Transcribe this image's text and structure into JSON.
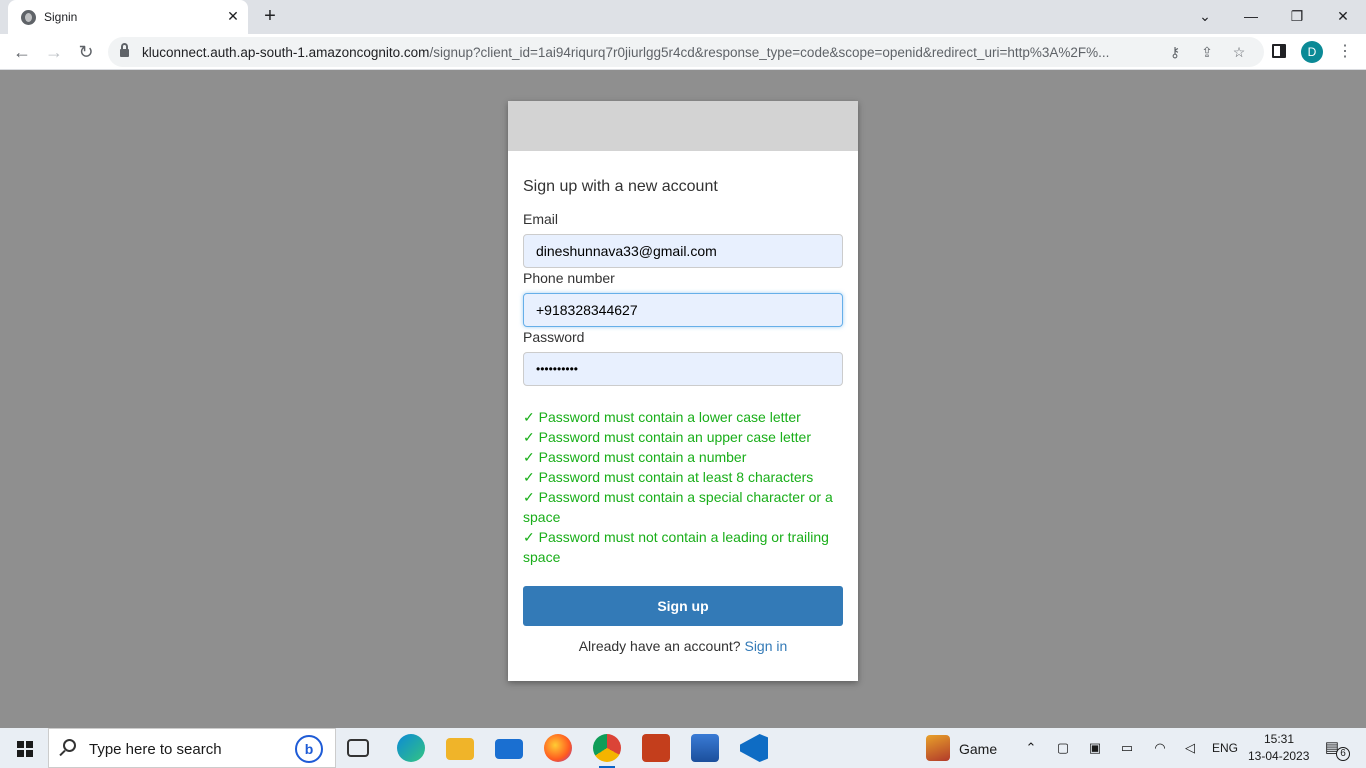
{
  "browser": {
    "tab": {
      "title": "Signin",
      "close": "✕"
    },
    "new_tab": "+",
    "window_controls": {
      "dropdown": "⌄",
      "minimize": "—",
      "restore": "❐",
      "close": "✕"
    },
    "nav": {
      "back": "←",
      "forward": "→",
      "reload": "↻"
    },
    "url_host": "kluconnect.auth.ap-south-1.amazoncognito.com",
    "url_rest": "/signup?client_id=1ai94riqurq7r0jiurlgg5r4cd&response_type=code&scope=openid&redirect_uri=http%3A%2F%...",
    "omnibox_icons": {
      "key": "⚷",
      "share": "⇪",
      "bookmark": "☆"
    },
    "profile_initial": "D",
    "menu": "⋮"
  },
  "form": {
    "heading": "Sign up with a new account",
    "email_label": "Email",
    "email_value": "dineshunnava33@gmail.com",
    "phone_label": "Phone number",
    "phone_value": "+918328344627",
    "password_label": "Password",
    "password_value": "••••••••••",
    "rules": [
      "✓ Password must contain a lower case letter",
      "✓ Password must contain an upper case letter",
      "✓ Password must contain a number",
      "✓ Password must contain at least 8 characters",
      "✓ Password must contain a special character or a space",
      "✓ Password must not contain a leading or trailing space"
    ],
    "signup_button": "Sign up",
    "already_text": "Already have an account?",
    "signin_link": "Sign in"
  },
  "taskbar": {
    "search_placeholder": "Type here to search",
    "bing": "b",
    "widget_label": "Game",
    "lang": "ENG",
    "time": "15:31",
    "date": "13-04-2023",
    "notification_count": "6"
  },
  "colors": {
    "backdrop": "#8f8f8f",
    "primary_button": "#337ab7",
    "rule_ok": "#19ae19",
    "input_fill": "#e8f0fe"
  }
}
